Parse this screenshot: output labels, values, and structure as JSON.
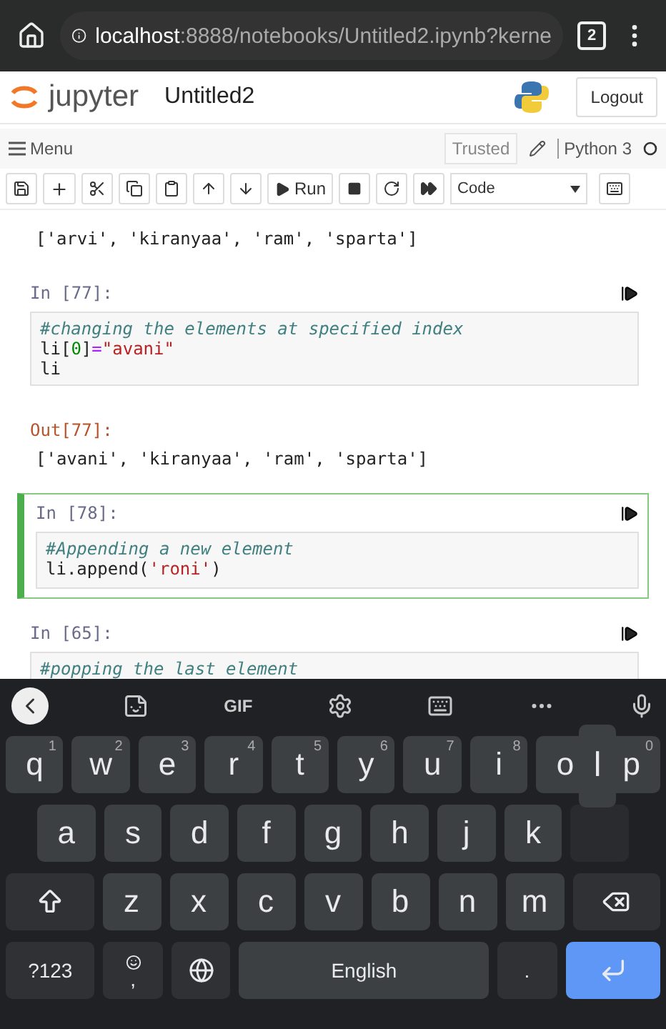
{
  "browser": {
    "url_host": "localhost",
    "url_path": ":8888/notebooks/Untitled2.ipynb?kerne",
    "tab_count": "2"
  },
  "header": {
    "logo_text": "jupyter",
    "notebook_title": "Untitled2",
    "logout": "Logout"
  },
  "menubar": {
    "menu": "Menu",
    "trusted": "Trusted",
    "kernel": "Python 3"
  },
  "toolbar": {
    "run": "Run",
    "cell_type": "Code"
  },
  "cells": [
    {
      "kind": "output",
      "lines": [
        [
          {
            "t": "['arvi', 'kiranyaa', 'ram', 'sparta']",
            "kind": "plain"
          }
        ]
      ]
    },
    {
      "kind": "input",
      "prompt": "In [77]:",
      "selected": false,
      "lines": [
        [
          {
            "t": "#changing the elements at specified index",
            "kind": "comment"
          }
        ],
        [
          {
            "t": "li[",
            "kind": "plain"
          },
          {
            "t": "0",
            "kind": "number"
          },
          {
            "t": "]",
            "kind": "plain"
          },
          {
            "t": "=",
            "kind": "op"
          },
          {
            "t": "\"avani\"",
            "kind": "string"
          }
        ],
        [
          {
            "t": "li",
            "kind": "plain"
          }
        ]
      ]
    },
    {
      "kind": "output",
      "prompt": "Out[77]:",
      "lines": [
        [
          {
            "t": "['avani', 'kiranyaa', 'ram', 'sparta']",
            "kind": "plain"
          }
        ]
      ]
    },
    {
      "kind": "input",
      "prompt": "In [78]:",
      "selected": true,
      "lines": [
        [
          {
            "t": "#Appending a new element",
            "kind": "comment"
          }
        ],
        [
          {
            "t": "li.append(",
            "kind": "plain"
          },
          {
            "t": "'roni'",
            "kind": "string"
          },
          {
            "t": ")",
            "kind": "plain"
          }
        ]
      ]
    },
    {
      "kind": "input",
      "prompt": "In [65]:",
      "selected": false,
      "lines": [
        [
          {
            "t": "#popping the last element",
            "kind": "comment"
          }
        ]
      ]
    }
  ],
  "keyboard": {
    "suggest_gif": "GIF",
    "key_preview": "l",
    "rows": [
      [
        {
          "kind": "letter",
          "label": "q",
          "hint": "1"
        },
        {
          "kind": "letter",
          "label": "w",
          "hint": "2"
        },
        {
          "kind": "letter",
          "label": "e",
          "hint": "3"
        },
        {
          "kind": "letter",
          "label": "r",
          "hint": "4"
        },
        {
          "kind": "letter",
          "label": "t",
          "hint": "5"
        },
        {
          "kind": "letter",
          "label": "y",
          "hint": "6"
        },
        {
          "kind": "letter",
          "label": "u",
          "hint": "7"
        },
        {
          "kind": "letter",
          "label": "i",
          "hint": "8"
        },
        {
          "kind": "letter",
          "label": "o"
        },
        {
          "kind": "letter",
          "label": "p",
          "hint": "0"
        }
      ],
      [
        {
          "kind": "letter",
          "label": "a"
        },
        {
          "kind": "letter",
          "label": "s"
        },
        {
          "kind": "letter",
          "label": "d"
        },
        {
          "kind": "letter",
          "label": "f"
        },
        {
          "kind": "letter",
          "label": "g"
        },
        {
          "kind": "letter",
          "label": "h"
        },
        {
          "kind": "letter",
          "label": "j"
        },
        {
          "kind": "letter",
          "label": "k"
        },
        {
          "kind": "letter",
          "pressed": true
        }
      ],
      [
        {
          "kind": "shift"
        },
        {
          "kind": "letter",
          "label": "z"
        },
        {
          "kind": "letter",
          "label": "x"
        },
        {
          "kind": "letter",
          "label": "c"
        },
        {
          "kind": "letter",
          "label": "v"
        },
        {
          "kind": "letter",
          "label": "b"
        },
        {
          "kind": "letter",
          "label": "n"
        },
        {
          "kind": "letter",
          "label": "m"
        },
        {
          "kind": "backspace"
        }
      ],
      [
        {
          "kind": "symbols",
          "label": "?123"
        },
        {
          "kind": "comma",
          "label": ","
        },
        {
          "kind": "globe"
        },
        {
          "kind": "space",
          "label": "English"
        },
        {
          "kind": "period",
          "label": "."
        },
        {
          "kind": "enter"
        }
      ]
    ]
  }
}
